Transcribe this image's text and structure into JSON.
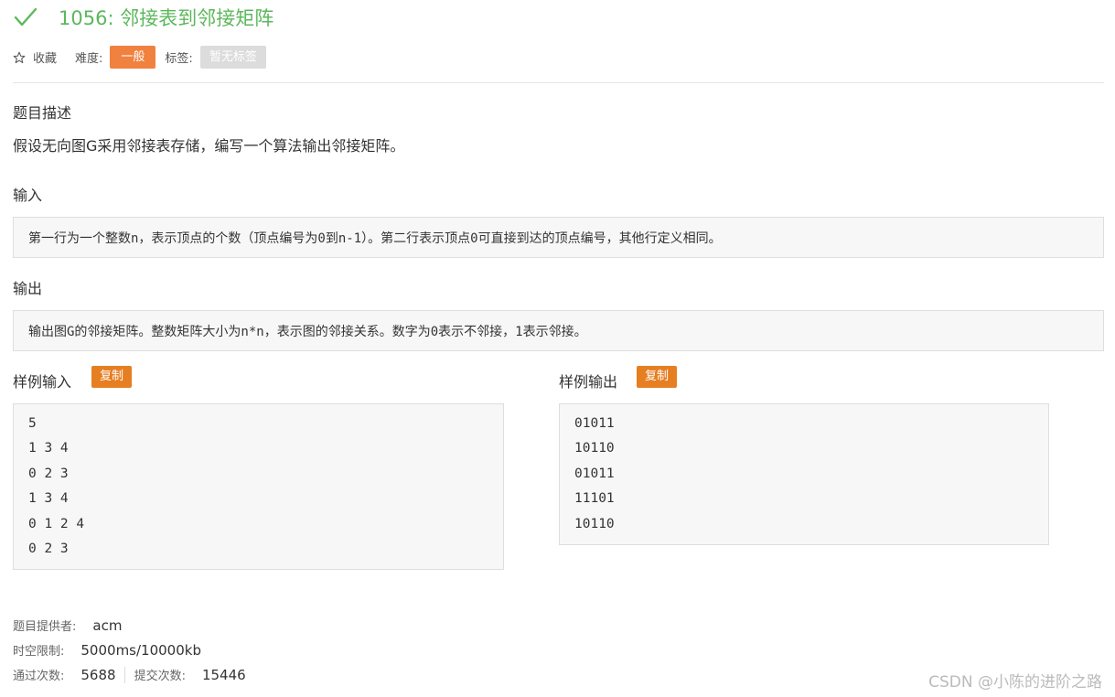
{
  "problem": {
    "title": "1056: 邻接表到邻接矩阵"
  },
  "meta": {
    "favorite_label": "收藏",
    "difficulty_label": "难度:",
    "difficulty_value": "一般",
    "tags_label": "标签:",
    "tags_value": "暂无标签"
  },
  "sections": {
    "description_heading": "题目描述",
    "description_text": "假设无向图G采用邻接表存储，编写一个算法输出邻接矩阵。",
    "input_heading": "输入",
    "input_text": "第一行为一个整数n，表示顶点的个数（顶点编号为0到n-1）。第二行表示顶点0可直接到达的顶点编号，其他行定义相同。",
    "output_heading": "输出",
    "output_text": "输出图G的邻接矩阵。整数矩阵大小为n*n，表示图的邻接关系。数字为0表示不邻接，1表示邻接。"
  },
  "sample_input": {
    "heading": "样例输入",
    "copy_label": "复制",
    "lines": [
      "5",
      "1 3 4",
      "0 2 3",
      "1 3 4",
      "0 1 2 4",
      "0 2 3"
    ]
  },
  "sample_output": {
    "heading": "样例输出",
    "copy_label": "复制",
    "lines": [
      "01011",
      "10110",
      "01011",
      "11101",
      "10110"
    ]
  },
  "footer": {
    "provider_label": "题目提供者:",
    "provider_value": "acm",
    "limit_label": "时空限制:",
    "limit_value": "5000ms/10000kb",
    "passed_label": "通过次数:",
    "passed_value": "5688",
    "submitted_label": "提交次数:",
    "submitted_value": "15446"
  },
  "watermark": "CSDN @小陈的进阶之路",
  "colors": {
    "title_green": "#5cb85c",
    "difficulty_orange": "#f0813e",
    "copy_orange": "#e67e22",
    "tag_gray": "#dcdcdc"
  },
  "icons": {
    "title": "check-icon",
    "favorite": "star-outline-icon"
  }
}
